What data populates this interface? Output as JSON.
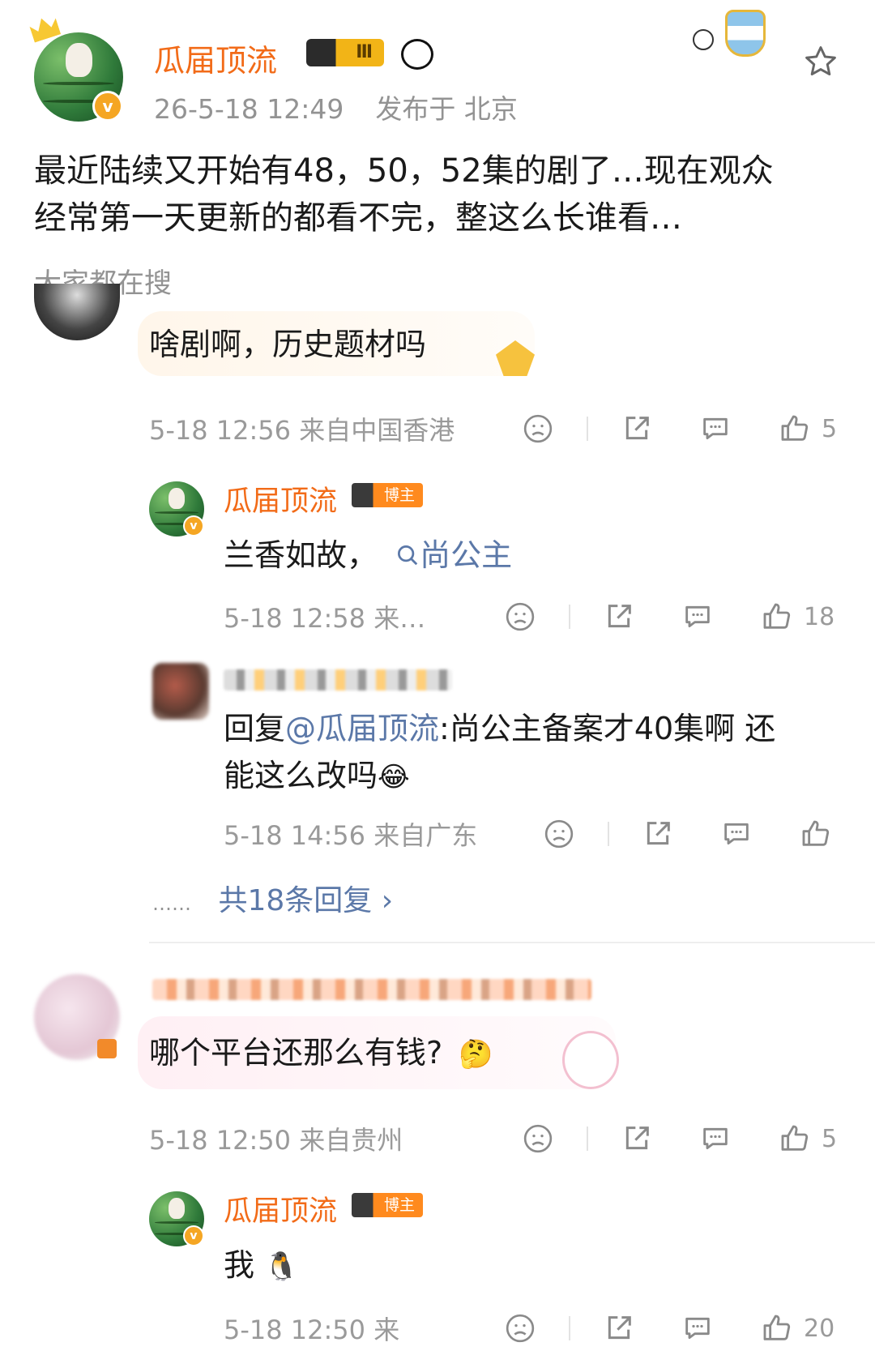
{
  "post": {
    "author": "瓜届顶流",
    "vip_level": "Ⅲ",
    "meta_time": "26-5-18 12:49",
    "meta_location": "发布于 北京",
    "text_line1": "最近陆续又开始有48，50，52集的剧了…现在观众",
    "text_line2": "经常第一天更新的都看不完，整这么长谁看…",
    "search_label": "大家都在搜"
  },
  "comments": [
    {
      "text": "啥剧啊，历史题材吗",
      "time": "5-18 12:56 来自中国香港",
      "likes": "5",
      "replies": [
        {
          "author": "瓜届顶流",
          "tag": "博主",
          "text": "兰香如故，",
          "search_term": "尚公主",
          "time": "5-18 12:58 来…",
          "likes": "18"
        },
        {
          "reply_prefix": "回复",
          "mention": "@瓜届顶流",
          "text_line1": ":尚公主备案才40集啊 还",
          "text_line2": "能这么改吗",
          "emoji": "😂",
          "time": "5-18 14:56 来自广东",
          "likes": ""
        }
      ],
      "more_replies": "共18条回复 ›",
      "dots": "……"
    },
    {
      "text": "哪个平台还那么有钱?",
      "emoji": "🤔",
      "time": "5-18 12:50 来自贵州",
      "likes": "5",
      "replies": [
        {
          "author": "瓜届顶流",
          "tag": "博主",
          "text": "我",
          "emoji": "🐧",
          "time": "5-18 12:50 来",
          "likes": "20"
        }
      ]
    }
  ],
  "colors": {
    "author_name": "#f26b18",
    "link": "#5b78a8",
    "meta": "#939393"
  },
  "icons": [
    "crown-icon",
    "vip-badge",
    "panda-icon",
    "argentina-badge-icon",
    "star-icon",
    "dislike-icon",
    "share-icon",
    "comment-icon",
    "like-icon",
    "search-icon",
    "chevron-right-icon"
  ]
}
